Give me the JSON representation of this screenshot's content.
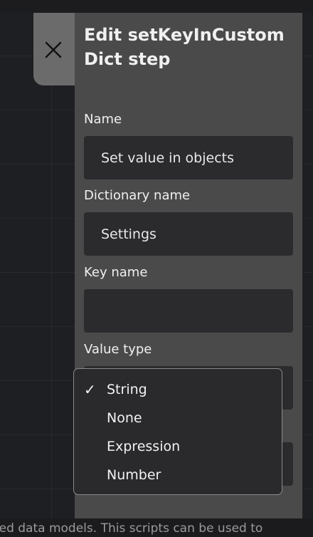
{
  "panel": {
    "title": "Edit setKeyInCustomDict step",
    "fields": {
      "name": {
        "label": "Name",
        "value": "Set value in objects",
        "placeholder": ""
      },
      "dictionary": {
        "label": "Dictionary name",
        "value": "Settings",
        "placeholder": ""
      },
      "key": {
        "label": "Key name",
        "value": "",
        "placeholder": ""
      },
      "value_type": {
        "label": "Value type",
        "selected": "String"
      }
    }
  },
  "dropdown": {
    "check_glyph": "✓",
    "options": [
      "String",
      "None",
      "Expression",
      "Number"
    ]
  },
  "background": {
    "text": "red data models. This scripts can be used to"
  },
  "icons": {
    "close": "close-icon",
    "check": "check-icon"
  },
  "colors": {
    "panel": "#4a4a4a",
    "close_tab": "#6b6b6b",
    "input": "#2b2b2e",
    "canvas": "#1e1f22"
  }
}
